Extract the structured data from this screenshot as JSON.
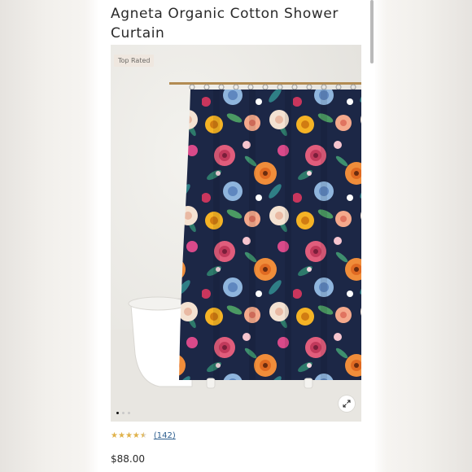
{
  "product": {
    "title": "Agneta Organic Cotton Shower Curtain",
    "badge": "Top Rated",
    "rating": 4.5,
    "rating_stars": [
      "★",
      "★",
      "★",
      "★",
      "★"
    ],
    "reviews_count": "(142)",
    "price": "$88.00"
  },
  "gallery": {
    "total_images": 3,
    "active_index": 0,
    "zoom_icon": "expand-icon"
  },
  "colors": {
    "curtain_base": "#1e2a4a",
    "star_fill": "#e0b24a",
    "link": "#2d5e8e",
    "badge_bg": "#efe7df"
  }
}
